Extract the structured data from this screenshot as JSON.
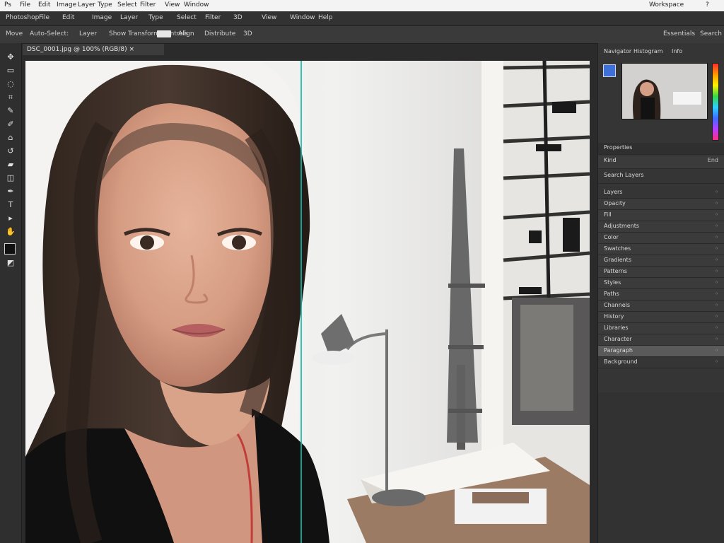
{
  "system_bar": {
    "items": [
      "Ps",
      "File",
      "Edit",
      "Image",
      "Layer",
      "Type",
      "Select",
      "Filter",
      "View",
      "Window"
    ],
    "right_items": [
      "Workspace",
      "?"
    ]
  },
  "menu_bar": {
    "items": [
      "Photoshop",
      "File",
      "Edit",
      "Image",
      "Layer",
      "Type",
      "Select",
      "Filter",
      "3D",
      "View",
      "Window",
      "Help"
    ]
  },
  "options_bar": {
    "items": [
      "Move",
      "Auto-Select:",
      "Layer",
      "Show Transform Controls",
      "Align",
      "Distribute",
      "3D"
    ],
    "right_items": [
      "Essentials",
      "Search"
    ]
  },
  "document_tab": {
    "title": "DSC_0001.jpg @ 100% (RGB/8) × "
  },
  "panel": {
    "tabs": [
      "Navigator",
      "Histogram",
      "Info"
    ],
    "header": "Properties",
    "properties_label": "Kind",
    "properties_value": "End",
    "search_label": "Search Layers",
    "sections": [
      {
        "label": "Layers"
      },
      {
        "label": "Opacity"
      },
      {
        "label": "Fill"
      },
      {
        "label": "Adjustments"
      },
      {
        "label": "Color"
      },
      {
        "label": "Swatches"
      },
      {
        "label": "Gradients"
      },
      {
        "label": "Patterns"
      },
      {
        "label": "Styles"
      },
      {
        "label": "Paths"
      },
      {
        "label": "Channels"
      },
      {
        "label": "History"
      },
      {
        "label": "Libraries"
      },
      {
        "label": "Character"
      },
      {
        "label": "Paragraph"
      },
      {
        "label": "Background"
      }
    ]
  },
  "colors": {
    "guide": "#15b8a9",
    "panel": "#353535",
    "menu": "#323232"
  }
}
